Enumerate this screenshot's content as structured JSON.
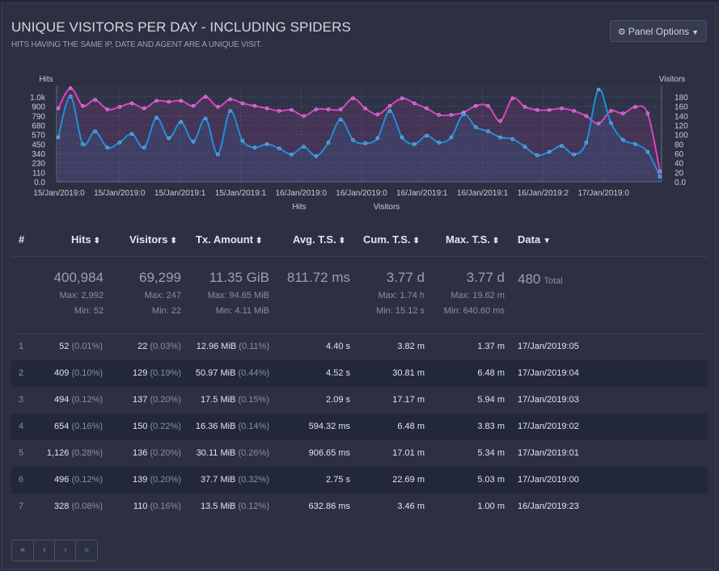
{
  "panel": {
    "title": "UNIQUE VISITORS PER DAY - INCLUDING SPIDERS",
    "subtitle": "HITS HAVING THE SAME IP, DATE AND AGENT ARE A UNIQUE VISIT.",
    "options_label": "Panel Options"
  },
  "chart_data": {
    "type": "line",
    "left_axis_label": "Hits",
    "right_axis_label": "Visitors",
    "left_ticks": [
      "1.0k",
      "900",
      "790",
      "680",
      "570",
      "450",
      "340",
      "230",
      "110",
      "0.0"
    ],
    "right_ticks": [
      "180",
      "160",
      "140",
      "120",
      "100",
      "80",
      "60",
      "40",
      "20",
      "0.0"
    ],
    "left_max": 1126,
    "right_max": 190,
    "x_tick_labels": [
      "15/Jan/2019:0",
      "15/Jan/2019:0",
      "15/Jan/2019:1",
      "15/Jan/2019:1",
      "16/Jan/2019:0",
      "16/Jan/2019:0",
      "16/Jan/2019:1",
      "16/Jan/2019:1",
      "16/Jan/2019:2",
      "17/Jan/2019:0"
    ],
    "legend": [
      "Hits",
      "Visitors"
    ],
    "colors": {
      "hits": "#1f8fd8",
      "visitors": "#e040c0"
    },
    "series": [
      {
        "name": "Hits",
        "values": [
          520,
          1000,
          440,
          590,
          400,
          460,
          560,
          400,
          750,
          510,
          700,
          470,
          740,
          320,
          830,
          480,
          400,
          440,
          390,
          320,
          410,
          300,
          460,
          730,
          490,
          450,
          510,
          830,
          520,
          440,
          540,
          460,
          520,
          790,
          640,
          590,
          520,
          500,
          410,
          310,
          350,
          420,
          320,
          460,
          1080,
          690,
          490,
          440,
          350,
          60
        ]
      },
      {
        "name": "Visitors",
        "values": [
          145,
          185,
          150,
          162,
          143,
          148,
          155,
          145,
          160,
          158,
          160,
          150,
          168,
          148,
          163,
          155,
          150,
          145,
          140,
          142,
          130,
          143,
          143,
          143,
          165,
          145,
          133,
          150,
          165,
          155,
          145,
          132,
          132,
          137,
          150,
          150,
          120,
          165,
          148,
          142,
          142,
          145,
          140,
          130,
          115,
          140,
          135,
          148,
          135,
          20
        ]
      }
    ]
  },
  "table": {
    "headers": {
      "idx": "#",
      "hits": "Hits",
      "visitors": "Visitors",
      "tx": "Tx. Amount",
      "avg": "Avg. T.S.",
      "cum": "Cum. T.S.",
      "max": "Max. T.S.",
      "data": "Data"
    },
    "summary": {
      "hits": {
        "total": "400,984",
        "max": "Max: 2,992",
        "min": "Min: 52"
      },
      "visitors": {
        "total": "69,299",
        "max": "Max: 247",
        "min": "Min: 22"
      },
      "tx": {
        "total": "11.35 GiB",
        "max": "Max: 94.65 MiB",
        "min": "Min: 4.11 MiB"
      },
      "avg": {
        "total": "811.72 ms"
      },
      "cum": {
        "total": "3.77 d",
        "max": "Max: 1.74 h",
        "min": "Min: 15.12 s"
      },
      "maxts": {
        "total": "3.77 d",
        "max": "Max: 19.62 m",
        "min": "Min: 640.60 ms"
      },
      "data": {
        "total": "480",
        "label": "Total"
      }
    },
    "rows": [
      {
        "idx": "1",
        "hits": "52",
        "hits_pct": "(0.01%)",
        "visitors": "22",
        "visitors_pct": "(0.03%)",
        "tx": "12.96 MiB",
        "tx_pct": "(0.11%)",
        "avg": "4.40 s",
        "cum": "3.82 m",
        "max": "1.37 m",
        "data": "17/Jan/2019:05"
      },
      {
        "idx": "2",
        "hits": "409",
        "hits_pct": "(0.10%)",
        "visitors": "129",
        "visitors_pct": "(0.19%)",
        "tx": "50.97 MiB",
        "tx_pct": "(0.44%)",
        "avg": "4.52 s",
        "cum": "30.81 m",
        "max": "6.48 m",
        "data": "17/Jan/2019:04"
      },
      {
        "idx": "3",
        "hits": "494",
        "hits_pct": "(0.12%)",
        "visitors": "137",
        "visitors_pct": "(0.20%)",
        "tx": "17.5 MiB",
        "tx_pct": "(0.15%)",
        "avg": "2.09 s",
        "cum": "17.17 m",
        "max": "5.94 m",
        "data": "17/Jan/2019:03"
      },
      {
        "idx": "4",
        "hits": "654",
        "hits_pct": "(0.16%)",
        "visitors": "150",
        "visitors_pct": "(0.22%)",
        "tx": "16.36 MiB",
        "tx_pct": "(0.14%)",
        "avg": "594.32 ms",
        "cum": "6.48 m",
        "max": "3.83 m",
        "data": "17/Jan/2019:02"
      },
      {
        "idx": "5",
        "hits": "1,126",
        "hits_pct": "(0.28%)",
        "visitors": "136",
        "visitors_pct": "(0.20%)",
        "tx": "30.11 MiB",
        "tx_pct": "(0.26%)",
        "avg": "906.65 ms",
        "cum": "17.01 m",
        "max": "5.34 m",
        "data": "17/Jan/2019:01"
      },
      {
        "idx": "6",
        "hits": "496",
        "hits_pct": "(0.12%)",
        "visitors": "139",
        "visitors_pct": "(0.20%)",
        "tx": "37.7 MiB",
        "tx_pct": "(0.32%)",
        "avg": "2.75 s",
        "cum": "22.69 m",
        "max": "5.03 m",
        "data": "17/Jan/2019:00"
      },
      {
        "idx": "7",
        "hits": "328",
        "hits_pct": "(0.08%)",
        "visitors": "110",
        "visitors_pct": "(0.16%)",
        "tx": "13.5 MiB",
        "tx_pct": "(0.12%)",
        "avg": "632.86 ms",
        "cum": "3.46 m",
        "max": "1.00 m",
        "data": "16/Jan/2019:23"
      }
    ]
  },
  "pagination": {
    "first": "«",
    "prev": "‹",
    "next": "›",
    "last": "»"
  }
}
